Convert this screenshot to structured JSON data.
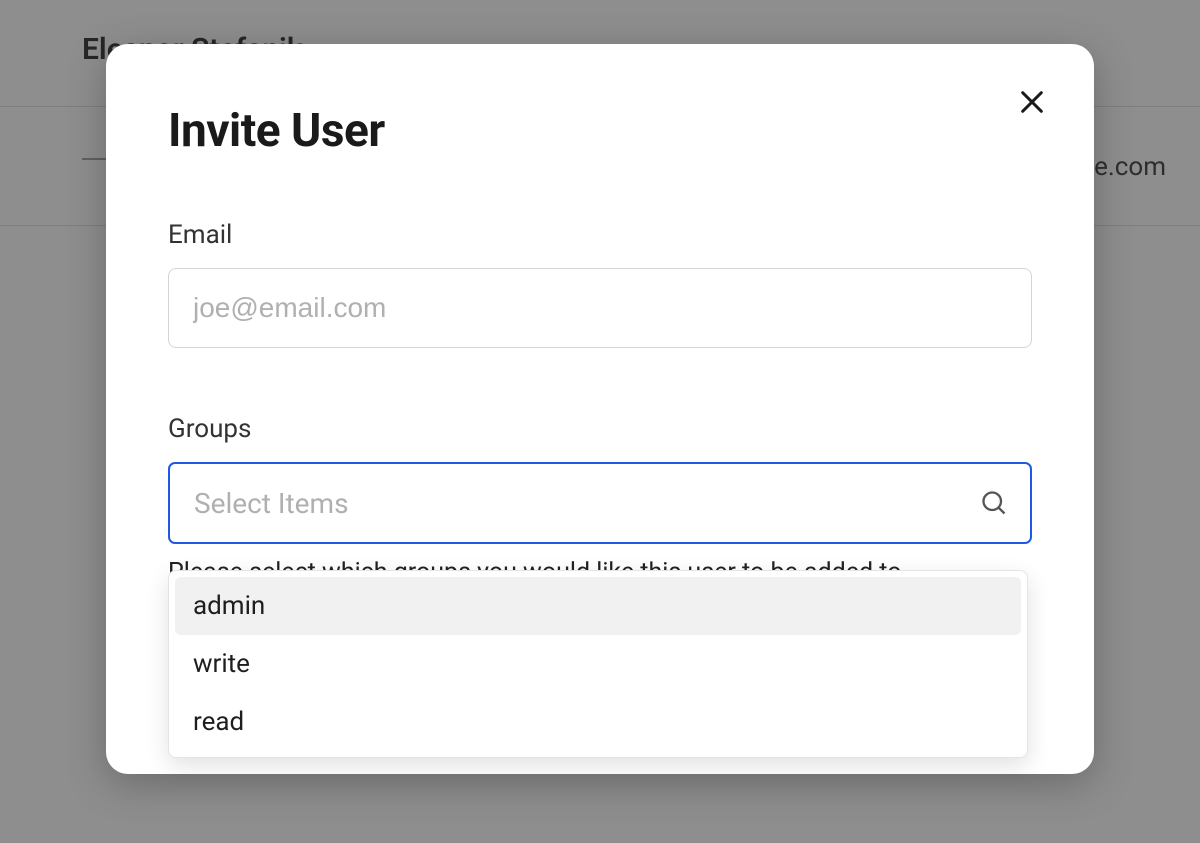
{
  "background": {
    "user_name": "Eleanor Stefanik",
    "email_fragment": "e.com"
  },
  "modal": {
    "title": "Invite User",
    "email": {
      "label": "Email",
      "placeholder": "joe@email.com",
      "value": ""
    },
    "groups": {
      "label": "Groups",
      "placeholder": "Select Items",
      "helper": "Please select which groups you would like this user to be added to",
      "options": [
        "admin",
        "write",
        "read"
      ],
      "highlighted_index": 0
    }
  }
}
